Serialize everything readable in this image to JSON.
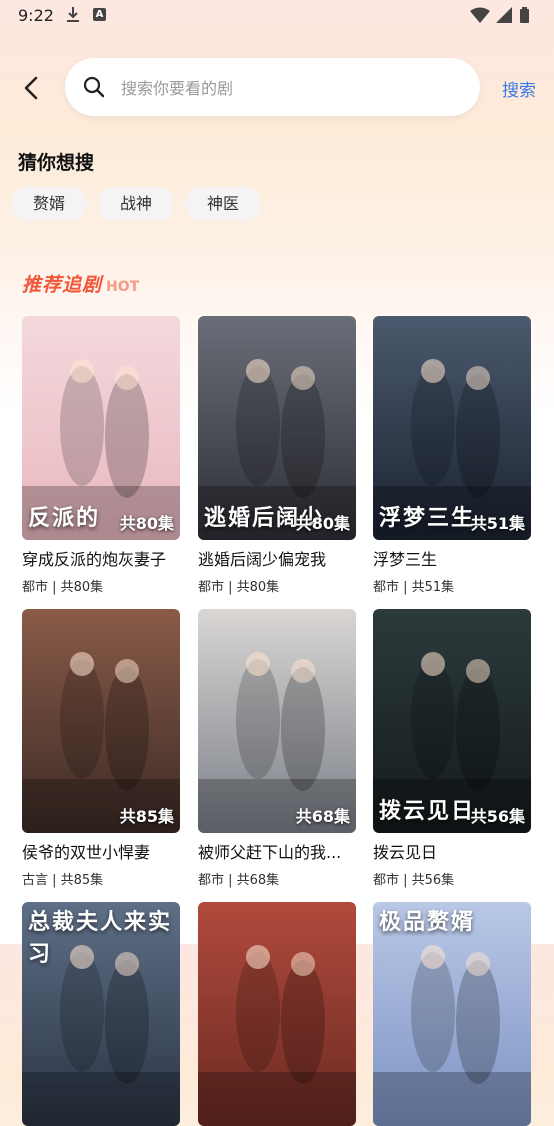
{
  "status": {
    "time": "9:22"
  },
  "search": {
    "placeholder": "搜索你要看的剧",
    "button": "搜索"
  },
  "guess": {
    "title": "猜你想搜",
    "chips": [
      "赘婿",
      "战神",
      "神医"
    ]
  },
  "recommend": {
    "title": "推荐追剧",
    "badge": "HOT"
  },
  "dramas": [
    {
      "name": "穿成反派的炮灰妻子",
      "meta": "都市 | 共80集",
      "episodes": "共80集",
      "poster_text": "反派的",
      "colors": [
        "#f3d9dc",
        "#e9b7bf"
      ]
    },
    {
      "name": "逃婚后阔少偏宠我",
      "meta": "都市 | 共80集",
      "episodes": "共80集",
      "poster_text": "逃婚后阔少",
      "colors": [
        "#6a6e78",
        "#2e2f36"
      ]
    },
    {
      "name": "浮梦三生",
      "meta": "都市 | 共51集",
      "episodes": "共51集",
      "poster_text": "浮梦三生",
      "colors": [
        "#4b5a6e",
        "#1a2230"
      ]
    },
    {
      "name": "侯爷的双世小悍妻",
      "meta": "古言 | 共85集",
      "episodes": "共85集",
      "poster_text": "",
      "colors": [
        "#8a5b48",
        "#3b2a25"
      ]
    },
    {
      "name": "被师父赶下山的我...",
      "meta": "都市 | 共68集",
      "episodes": "共68集",
      "poster_text": "",
      "colors": [
        "#d9d6d4",
        "#7a7f88"
      ]
    },
    {
      "name": "拨云见日",
      "meta": "都市 | 共56集",
      "episodes": "共56集",
      "poster_text": "拨云见日",
      "colors": [
        "#2c3a3c",
        "#141a1c"
      ]
    },
    {
      "name": "",
      "meta": "",
      "episodes": "",
      "poster_text": "总裁夫人来实习",
      "colors": [
        "#5e6f86",
        "#2a3444"
      ]
    },
    {
      "name": "",
      "meta": "",
      "episodes": "",
      "poster_text": "",
      "colors": [
        "#b04a3c",
        "#6b2a22"
      ]
    },
    {
      "name": "",
      "meta": "",
      "episodes": "",
      "poster_text": "极品赘婿",
      "colors": [
        "#b9c8e6",
        "#7d93c4"
      ]
    }
  ]
}
